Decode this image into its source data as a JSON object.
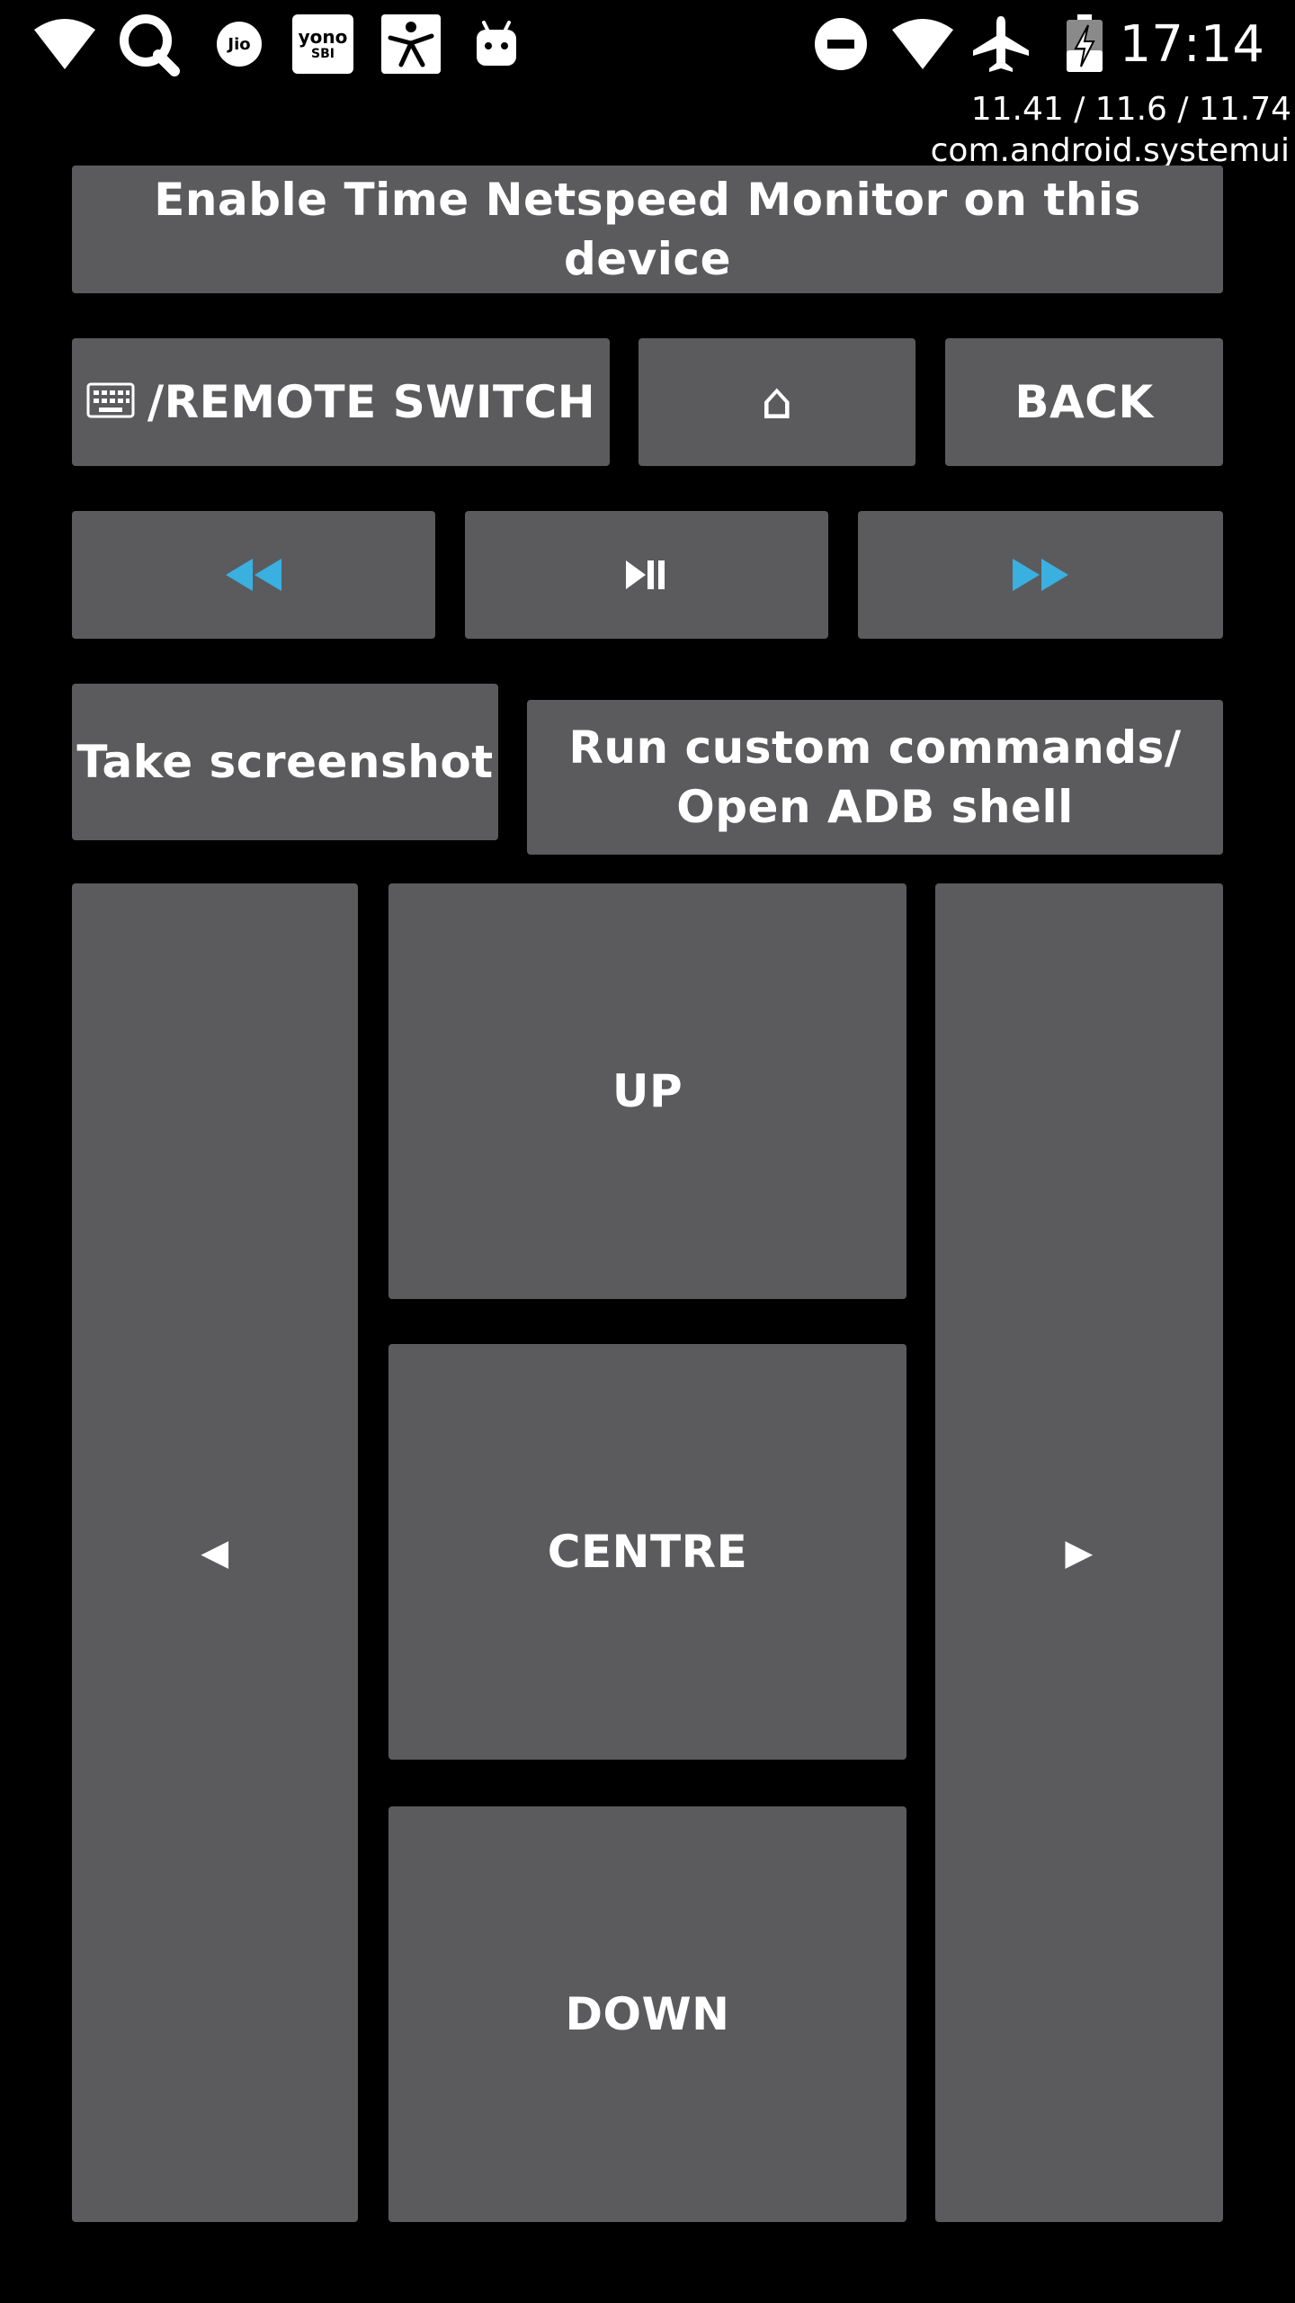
{
  "status_bar": {
    "left_icons": [
      "wifi-icon",
      "search-app-icon",
      "jio-icon",
      "yono-sbi-icon",
      "fitness-app-icon",
      "android-icon"
    ],
    "jio_label": "Jio",
    "yono_label_top": "yono",
    "yono_label_bottom": "SBI",
    "right_icons": [
      "do-not-disturb-icon",
      "wifi-signal-icon",
      "airplane-mode-icon",
      "battery-charging-icon"
    ],
    "time": "17:14"
  },
  "overlay": {
    "cpu_load": "11.41 / 11.6 / 11.74",
    "current_app": "com.android.systemui"
  },
  "buttons": {
    "enable_monitor": "Enable Time Netspeed Monitor on this device",
    "remote_switch": "/REMOTE SWITCH",
    "home": "⌂",
    "back": "BACK",
    "rewind": "◀◀",
    "play_pause": "▶II",
    "fast_forward": "▶▶",
    "screenshot": "Take screenshot",
    "custom_commands_line1": "Run custom commands/",
    "custom_commands_line2": "Open ADB shell",
    "left": "◀",
    "up": "UP",
    "centre": "CENTRE",
    "down": "DOWN",
    "right": "▶"
  },
  "colors": {
    "background": "#000000",
    "button": "#5b5b5d",
    "text": "#ffffff",
    "media_accent": "#3ab0e0"
  }
}
